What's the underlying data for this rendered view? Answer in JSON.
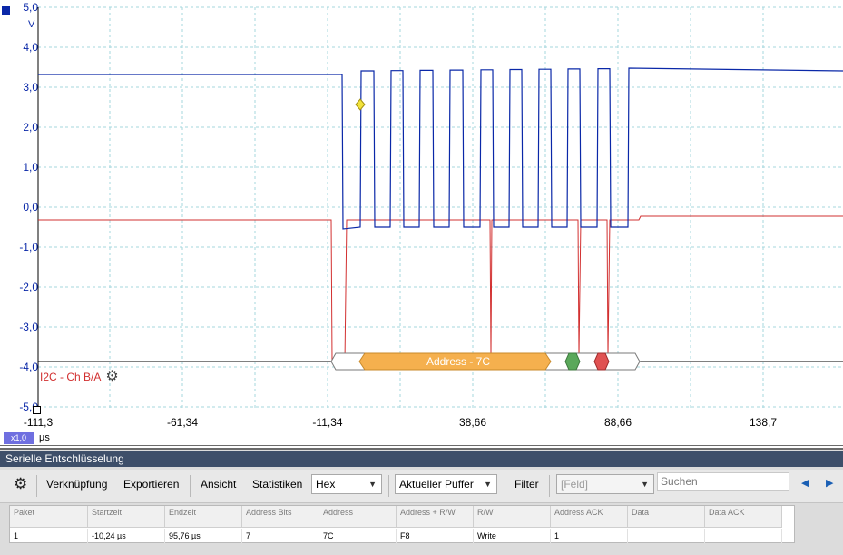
{
  "scope": {
    "y_unit": "V",
    "y_ticks": [
      "5,0",
      "4,0",
      "3,0",
      "2,0",
      "1,0",
      "0,0",
      "-1,0",
      "-2,0",
      "-3,0",
      "-4,0",
      "-5,0"
    ],
    "x_ticks": [
      "-111,3",
      "-61,34",
      "-11,34",
      "38,66",
      "88,66",
      "138,7"
    ],
    "x_unit": "µs",
    "zoom": "x1,0",
    "channel_label": "I2C - Ch B/A",
    "decode_label": "Address - 7C",
    "colors": {
      "channel_a": "#0a28a8",
      "channel_b": "#d23030",
      "decode_fill": "#f5b04e",
      "ack_green": "#5aa85a",
      "nack_red": "#e05252"
    }
  },
  "panel": {
    "title": "Serielle Entschlüsselung",
    "toolbar": {
      "link_label": "Verknüpfung",
      "export_label": "Exportieren",
      "view_label": "Ansicht",
      "stats_label": "Statistiken",
      "format_value": "Hex",
      "buffer_value": "Aktueller Puffer",
      "filter_label": "Filter",
      "field_value": "[Feld]",
      "search_placeholder": "Suchen"
    },
    "table": {
      "columns": [
        "Paket",
        "Startzeit",
        "Endzeit",
        "Address Bits",
        "Address",
        "Address + R/W",
        "R/W",
        "Address ACK",
        "Data",
        "Data ACK"
      ],
      "rows": [
        [
          "1",
          "-10,24 µs",
          "95,76 µs",
          "7",
          "7C",
          "F8",
          "Write",
          "1",
          "",
          ""
        ]
      ]
    }
  }
}
